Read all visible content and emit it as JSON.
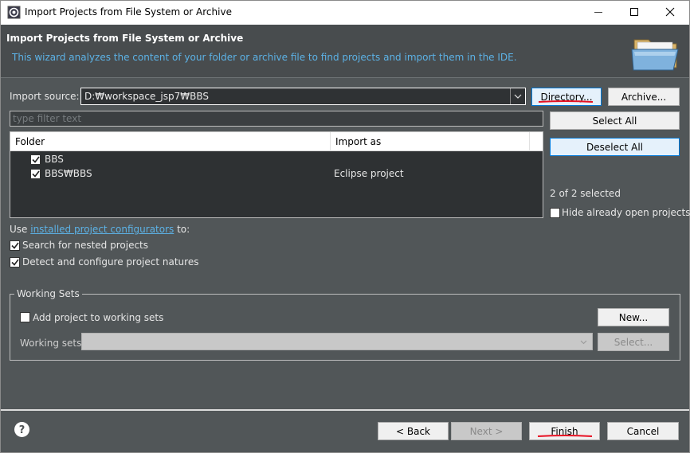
{
  "window": {
    "title": "Import Projects from File System or Archive"
  },
  "header": {
    "title": "Import Projects from File System or Archive",
    "description": "This wizard analyzes the content of your folder or archive file to find projects and import them in the IDE."
  },
  "import_source": {
    "label": "Import source:",
    "value": "D:₩workspace_jsp7₩BBS",
    "directory_button": "Directory...",
    "archive_button": "Archive..."
  },
  "filter": {
    "placeholder": "type filter text"
  },
  "actions": {
    "select_all": "Select All",
    "deselect_all": "Deselect All",
    "selection_count": "2 of 2 selected",
    "hide_open_projects": "Hide already open projects"
  },
  "table": {
    "columns": [
      "Folder",
      "Import as"
    ],
    "rows": [
      {
        "folder": "BBS",
        "import_as": "",
        "checked": true
      },
      {
        "folder": "BBS₩BBS",
        "import_as": "Eclipse project",
        "checked": true
      }
    ]
  },
  "configurators": {
    "prefix": "Use ",
    "link": "installed project configurators",
    "suffix": " to:"
  },
  "options": {
    "nested": "Search for nested projects",
    "natures": "Detect and configure project natures"
  },
  "working_sets": {
    "legend": "Working Sets",
    "add_label": "Add project to working sets",
    "new_button": "New...",
    "sets_label": "Working sets:",
    "select_button": "Select..."
  },
  "footer": {
    "back": "< Back",
    "next": "Next >",
    "finish": "Finish",
    "cancel": "Cancel"
  },
  "colors": {
    "dialog_bg": "#515658",
    "header_bg": "#484c4e",
    "link": "#5cb2e6",
    "annotation_red": "#e81123"
  }
}
